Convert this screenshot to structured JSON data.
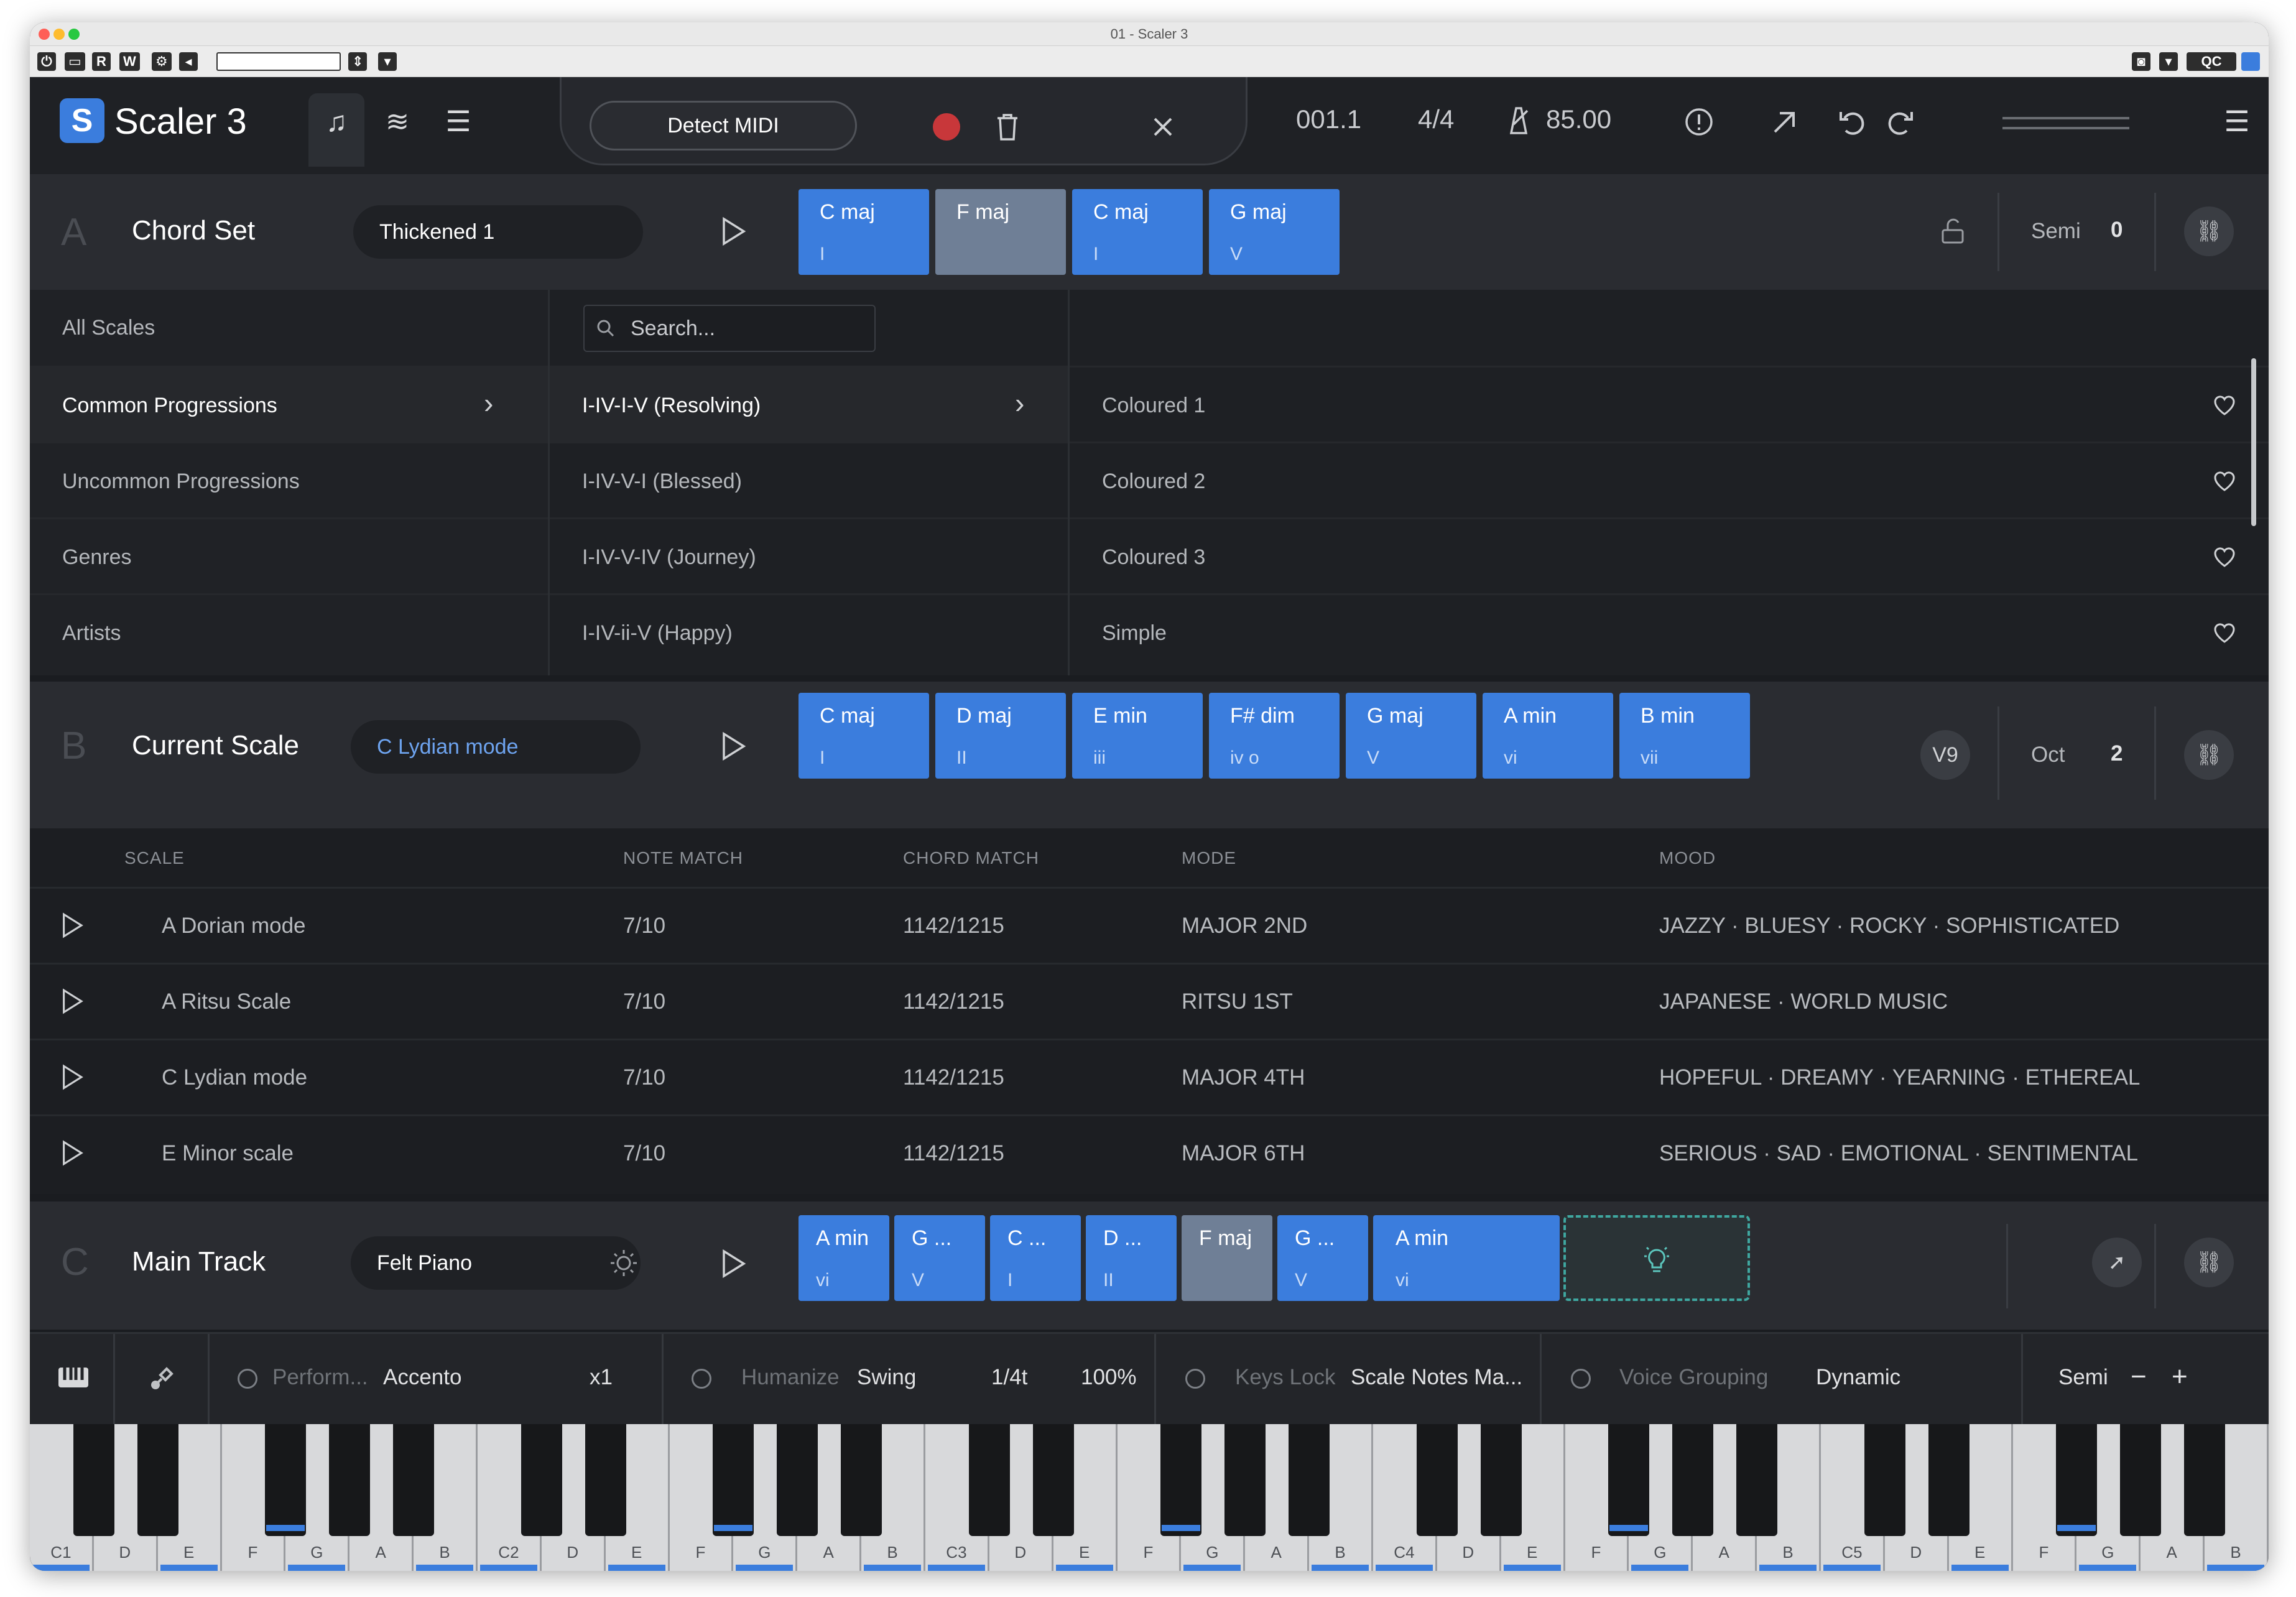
{
  "window": {
    "title": "01 - Scaler 3"
  },
  "app": {
    "name": "Scaler 3",
    "logo_letter": "S"
  },
  "header": {
    "detect_midi": "Detect MIDI",
    "position": "001.1",
    "time_signature": "4/4",
    "tempo": "85.00"
  },
  "host": {
    "buttons": [
      "R",
      "W",
      "QC"
    ]
  },
  "section_a": {
    "letter": "A",
    "name": "Chord Set",
    "preset": "Thickened 1",
    "chords": [
      {
        "name": "C maj",
        "roman": "I"
      },
      {
        "name": "F maj",
        "roman": ""
      },
      {
        "name": "C maj",
        "roman": "I"
      },
      {
        "name": "G maj",
        "roman": "V"
      }
    ],
    "semi_label": "Semi",
    "semi_value": "0"
  },
  "browser": {
    "categories": [
      "All Scales",
      "Common Progressions",
      "Uncommon Progressions",
      "Genres",
      "Artists"
    ],
    "search_placeholder": "Search...",
    "progressions": [
      "I-IV-I-V (Resolving)",
      "I-IV-V-I (Blessed)",
      "I-IV-V-IV (Journey)",
      "I-IV-ii-V (Happy)"
    ],
    "variations": [
      "Coloured 1",
      "Coloured 2",
      "Coloured 3",
      "Simple"
    ]
  },
  "section_b": {
    "letter": "B",
    "name": "Current Scale",
    "scale": "C Lydian mode",
    "chords": [
      {
        "name": "C maj",
        "roman": "I"
      },
      {
        "name": "D maj",
        "roman": "II"
      },
      {
        "name": "E min",
        "roman": "iii"
      },
      {
        "name": "F# dim",
        "roman": "iv o"
      },
      {
        "name": "G maj",
        "roman": "V"
      },
      {
        "name": "A min",
        "roman": "vi"
      },
      {
        "name": "B min",
        "roman": "vii"
      }
    ],
    "voicing_label": "V9",
    "oct_label": "Oct",
    "oct_value": "2"
  },
  "scale_table": {
    "headers": [
      "SCALE",
      "NOTE MATCH",
      "CHORD MATCH",
      "MODE",
      "MOOD"
    ],
    "rows": [
      {
        "scale": "A Dorian mode",
        "note_match": "7/10",
        "chord_match": "1142/1215",
        "mode": "MAJOR  2ND",
        "mood": "JAZZY  ·  BLUESY  ·  ROCKY  ·  SOPHISTICATED"
      },
      {
        "scale": "A Ritsu Scale",
        "note_match": "7/10",
        "chord_match": "1142/1215",
        "mode": "RITSU  1ST",
        "mood": "JAPANESE  ·  WORLD MUSIC"
      },
      {
        "scale": "C Lydian mode",
        "note_match": "7/10",
        "chord_match": "1142/1215",
        "mode": "MAJOR  4TH",
        "mood": "HOPEFUL  ·  DREAMY  ·  YEARNING  ·  ETHEREAL"
      },
      {
        "scale": "E Minor scale",
        "note_match": "7/10",
        "chord_match": "1142/1215",
        "mode": "MAJOR  6TH",
        "mood": "SERIOUS  ·  SAD  ·  EMOTIONAL  ·  SENTIMENTAL"
      }
    ]
  },
  "section_c": {
    "letter": "C",
    "name": "Main Track",
    "instrument": "Felt Piano",
    "chords": [
      {
        "name": "A min",
        "roman": "vi"
      },
      {
        "name": "G ...",
        "roman": "V"
      },
      {
        "name": "C ...",
        "roman": "I"
      },
      {
        "name": "D ...",
        "roman": "II"
      },
      {
        "name": "F maj",
        "roman": ""
      },
      {
        "name": "G ...",
        "roman": "V"
      },
      {
        "name": "A min",
        "roman": "vi"
      }
    ]
  },
  "bottom_bar": {
    "perform_label": "Perform...",
    "perform_value": "Accento",
    "perform_rate": "x1",
    "humanize_label": "Humanize",
    "humanize_value": "Swing",
    "humanize_div": "1/4t",
    "humanize_pct": "100%",
    "keys_lock_label": "Keys Lock",
    "keys_lock_value": "Scale Notes Ma...",
    "voice_label": "Voice Grouping",
    "voice_value": "Dynamic",
    "semi_label": "Semi",
    "minus": "−",
    "plus": "+"
  },
  "keyboard": {
    "labels": [
      "C1",
      "D",
      "E",
      "F",
      "G",
      "A",
      "B",
      "C2",
      "D",
      "E",
      "F",
      "G",
      "A",
      "B",
      "C3",
      "D",
      "E",
      "F",
      "G",
      "A",
      "B",
      "C4",
      "D",
      "E",
      "F",
      "G",
      "A",
      "B",
      "C5",
      "D",
      "E",
      "F",
      "G",
      "A",
      "B"
    ]
  },
  "colors": {
    "accent": "#3b7ddd",
    "chord_muted": "#6f7f96",
    "record": "#c8373a",
    "idea_border": "#3fa7a0"
  }
}
